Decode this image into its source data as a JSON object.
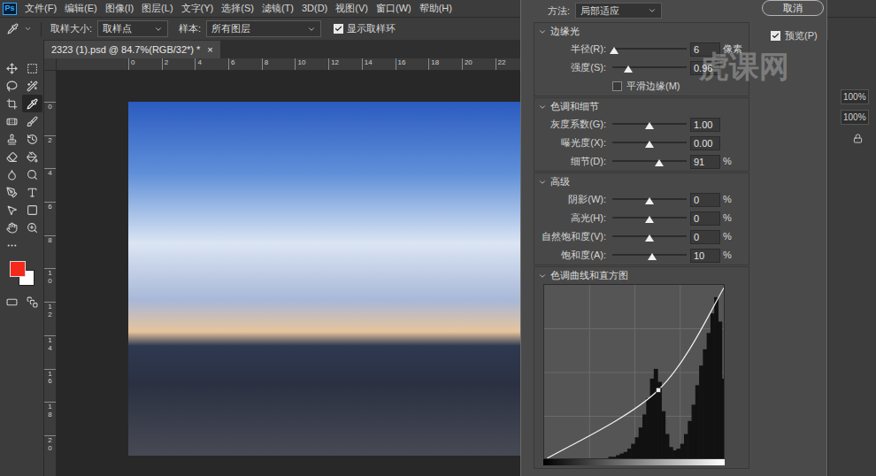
{
  "app": {
    "logo": "Ps",
    "menu": [
      "文件(F)",
      "编辑(E)",
      "图像(I)",
      "图层(L)",
      "文字(Y)",
      "选择(S)",
      "滤镜(T)",
      "3D(D)",
      "视图(V)",
      "窗口(W)",
      "帮助(H)"
    ]
  },
  "options_bar": {
    "sample_size_label": "取样大小:",
    "sample_size": "取样点",
    "sample_label": "样本:",
    "sample": "所有图层",
    "show_ring": {
      "label": "显示取样环",
      "checked": true
    }
  },
  "document_tab": {
    "title": "2323 (1).psd @ 84.7%(RGB/32*) *",
    "close": "×",
    "selected": true
  },
  "rulers": {
    "top": [
      "0",
      "2",
      "4",
      "6",
      "8",
      "10",
      "12",
      "14",
      "16",
      "18",
      "20",
      "22"
    ],
    "left": [
      "0",
      "2",
      "4",
      "6",
      "8",
      "10",
      "12",
      "14",
      "16",
      "18",
      "20"
    ]
  },
  "tools": [
    {
      "selected": false
    },
    {
      "selected": false
    },
    {
      "selected": false
    },
    {
      "selected": false
    },
    {
      "selected": false
    },
    {
      "selected": true
    },
    {
      "selected": false
    },
    {
      "selected": false
    },
    {
      "selected": false
    },
    {
      "selected": false
    },
    {
      "selected": false
    },
    {
      "selected": false
    },
    {
      "selected": false
    },
    {
      "selected": false
    },
    {
      "selected": false
    },
    {
      "selected": false
    },
    {
      "selected": false
    },
    {
      "selected": false
    },
    {
      "selected": false
    },
    {
      "selected": false
    },
    {
      "selected": false
    }
  ],
  "swatches": [
    {
      "name": "foreground",
      "color": "#f5281c"
    },
    {
      "name": "background",
      "color": "#ffffff"
    }
  ],
  "dialog": {
    "method_label": "方法:",
    "method": "局部适应",
    "cancel": "取消",
    "preview": {
      "label": "预览(P)",
      "checked": true
    },
    "sections": [
      {
        "title": "边缘光",
        "expanded": true,
        "rows": [
          {
            "kind": "slider",
            "label": "半径(R):",
            "level": 0.02,
            "value": "6",
            "unit": "像素"
          },
          {
            "kind": "slider",
            "label": "强度(S):",
            "level": 0.22,
            "value": "0.96"
          },
          {
            "kind": "checkbox",
            "label": "平滑边缘(M)",
            "checked": false
          }
        ]
      },
      {
        "title": "色调和细节",
        "expanded": true,
        "rows": [
          {
            "kind": "slider",
            "label": "灰度系数(G):",
            "level": 0.5,
            "value": "1.00"
          },
          {
            "kind": "slider",
            "label": "曝光度(X):",
            "level": 0.5,
            "value": "0.00"
          },
          {
            "kind": "slider",
            "label": "细节(D):",
            "level": 0.63,
            "value": "91",
            "unit": "%"
          }
        ]
      },
      {
        "title": "高级",
        "expanded": true,
        "rows": [
          {
            "kind": "slider",
            "label": "阴影(W):",
            "level": 0.5,
            "value": "0",
            "unit": "%"
          },
          {
            "kind": "slider",
            "label": "高光(H):",
            "level": 0.5,
            "value": "0",
            "unit": "%"
          },
          {
            "kind": "slider",
            "label": "自然饱和度(V):",
            "level": 0.5,
            "value": "0",
            "unit": "%"
          },
          {
            "kind": "slider",
            "label": "饱和度(A):",
            "level": 0.53,
            "value": "10",
            "unit": "%"
          }
        ]
      },
      {
        "title": "色调曲线和直方图",
        "expanded": true,
        "chart": {
          "curve": [
            [
              0,
              0
            ],
            [
              0.63,
              0.4
            ],
            [
              1,
              1
            ]
          ],
          "histogram": [
            0,
            0,
            0,
            0,
            0,
            0,
            0,
            0,
            0,
            0,
            0,
            0,
            0,
            0,
            0,
            0,
            0.01,
            0.02,
            0.02,
            0.03,
            0.04,
            0.05,
            0.07,
            0.1,
            0.14,
            0.2,
            0.28,
            0.38,
            0.5,
            0.56,
            0.48,
            0.3,
            0.16,
            0.08,
            0.06,
            0.07,
            0.1,
            0.16,
            0.24,
            0.34,
            0.46,
            0.58,
            0.68,
            0.78,
            0.9,
            1.0,
            0.85,
            0.5
          ]
        }
      }
    ]
  },
  "right_panel": {
    "fields": [
      "100%",
      "100%"
    ]
  },
  "watermark": "虎课网"
}
